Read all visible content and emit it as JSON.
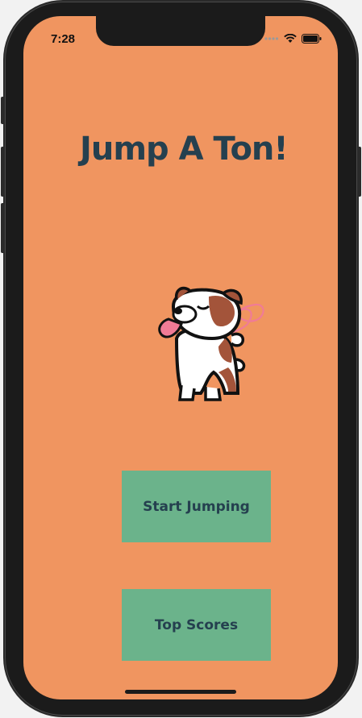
{
  "status_bar": {
    "time": "7:28"
  },
  "main": {
    "title": "Jump A Ton!",
    "start_button_label": "Start Jumping",
    "top_scores_button_label": "Top Scores"
  },
  "colors": {
    "screen_background": "#f09560",
    "button_background": "#6bb38b",
    "text_dark": "#25404f"
  }
}
